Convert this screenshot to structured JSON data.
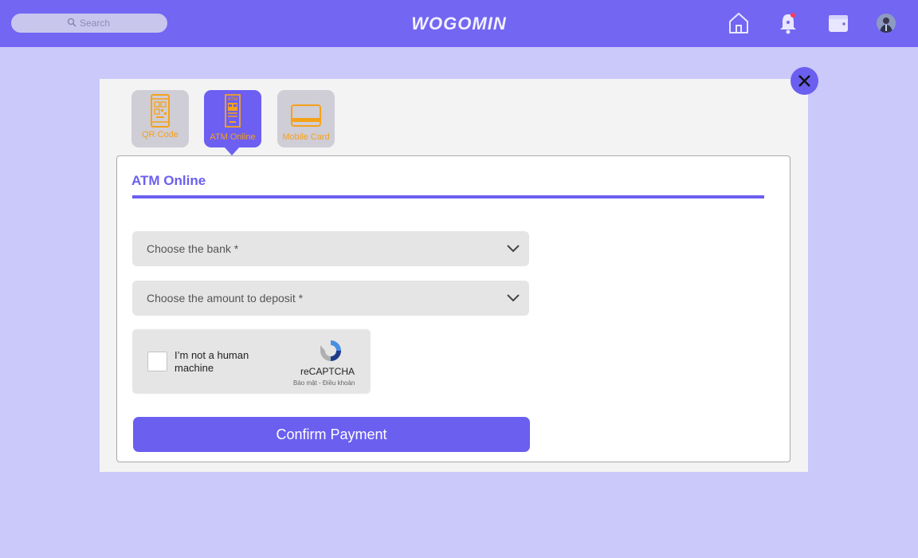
{
  "header": {
    "search": {
      "placeholder": "Search"
    },
    "logo_text": "WOGOMIN",
    "icons": [
      "home-icon",
      "bell-icon",
      "wallet-icon",
      "avatar"
    ]
  },
  "payment_tabs": [
    {
      "label": "QR Code",
      "icon": "qr-phone-icon",
      "active": false
    },
    {
      "label": "ATM Online",
      "icon": "atm-icon",
      "active": true
    },
    {
      "label": "Mobile Card",
      "icon": "card-icon",
      "active": false
    }
  ],
  "form": {
    "title": "ATM Online",
    "bank_select": {
      "value": "Choose the bank *"
    },
    "amount_select": {
      "value": "Choose the amount to deposit *"
    },
    "captcha": {
      "text": "I’m not a human machine",
      "brand": "reCAPTCHA",
      "terms": "Bảo mật - Điều khoản"
    },
    "confirm_label": "Confirm Payment"
  },
  "colors": {
    "accent": "#6b5ff0",
    "header_bg": "#7266f2",
    "page_bg": "#cbc8fa",
    "tab_label": "#f5a21b"
  }
}
